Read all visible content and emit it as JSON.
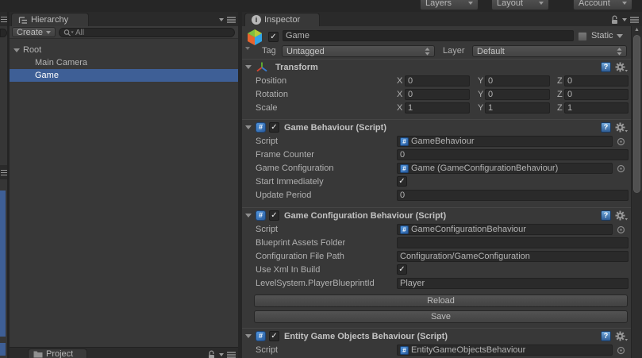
{
  "toolbar": {
    "layers": "Layers",
    "layout": "Layout",
    "account": "Account"
  },
  "icons": {
    "check": "✓",
    "scroll_up": "▲"
  },
  "colors": {
    "selection_blue": "#3e5f96",
    "panel_bg": "#383838",
    "tabbar_bg": "#2a2a2a",
    "script_icon_blue": "#2a5d9f"
  },
  "hierarchy": {
    "tab_label": "Hierarchy",
    "create_label": "Create",
    "search_text": "All",
    "items": [
      {
        "label": "Root",
        "depth": 0,
        "expanded": true,
        "selected": false
      },
      {
        "label": "Main Camera",
        "depth": 1,
        "selected": false
      },
      {
        "label": "Game",
        "depth": 1,
        "selected": true
      }
    ],
    "bottom_tab_label": "Project"
  },
  "inspector": {
    "tab_label": "Inspector",
    "gameobject": {
      "name": "Game",
      "active_checked": true,
      "static_label": "Static",
      "static_checked": false,
      "tag_label": "Tag",
      "tag_value": "Untagged",
      "layer_label": "Layer",
      "layer_value": "Default"
    },
    "transform": {
      "title": "Transform",
      "axis": {
        "x": "X",
        "y": "Y",
        "z": "Z"
      },
      "position": {
        "label": "Position",
        "x": "0",
        "y": "0",
        "z": "0"
      },
      "rotation": {
        "label": "Rotation",
        "x": "0",
        "y": "0",
        "z": "0"
      },
      "scale": {
        "label": "Scale",
        "x": "1",
        "y": "1",
        "z": "1"
      }
    },
    "game_behaviour": {
      "title": "Game Behaviour (Script)",
      "enabled": true,
      "script_label": "Script",
      "script_value": "GameBehaviour",
      "frame_counter_label": "Frame Counter",
      "frame_counter_value": "0",
      "game_configuration_label": "Game Configuration",
      "game_configuration_value": "Game (GameConfigurationBehaviour)",
      "start_immediately_label": "Start Immediately",
      "start_immediately_checked": true,
      "update_period_label": "Update Period",
      "update_period_value": "0"
    },
    "game_configuration_behaviour": {
      "title": "Game Configuration Behaviour (Script)",
      "enabled": true,
      "script_label": "Script",
      "script_value": "GameConfigurationBehaviour",
      "blueprint_assets_folder_label": "Blueprint Assets Folder",
      "blueprint_assets_folder_value": "",
      "configuration_file_path_label": "Configuration File Path",
      "configuration_file_path_value": "Configuration/GameConfiguration",
      "use_xml_label": "Use Xml In Build",
      "use_xml_checked": true,
      "player_blueprint_label": "LevelSystem.PlayerBlueprintId",
      "player_blueprint_value": "Player",
      "reload_label": "Reload",
      "save_label": "Save"
    },
    "entity_game_objects_behaviour": {
      "title": "Entity Game Objects Behaviour (Script)",
      "enabled": true,
      "script_label": "Script",
      "script_value": "EntityGameObjectsBehaviour"
    }
  }
}
